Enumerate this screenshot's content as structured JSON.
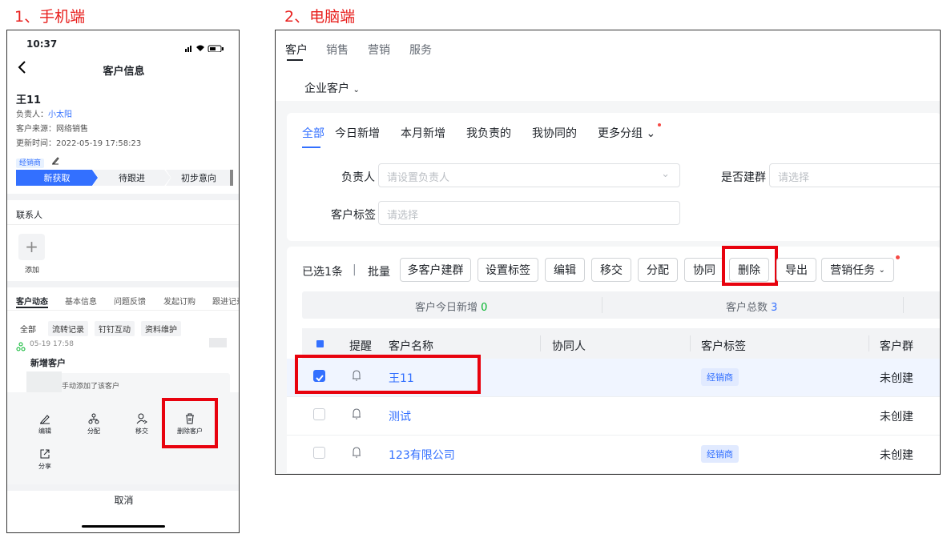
{
  "section1_title": "1、手机端",
  "section2_title": "2、电脑端",
  "mobile": {
    "time": "10:37",
    "nav_title": "客户信息",
    "customer_name": "王11",
    "owner_label": "负责人：",
    "owner_value": "小太阳",
    "source": "客户来源：网络销售",
    "updated": "更新时间：2022-05-19 17:58:23",
    "tag": "经销商",
    "stages": [
      "新获取",
      "待跟进",
      "初步意向"
    ],
    "contacts_title": "联系人",
    "add_label": "添加",
    "tabs": [
      "客户动态",
      "基本信息",
      "问题反馈",
      "发起订购",
      "跟进记录"
    ],
    "filters": [
      "全部",
      "流转记录",
      "钉钉互动",
      "资料维护"
    ],
    "event_time": "05-19 17:58",
    "event_title": "新增客户",
    "event_desc": "手动添加了该客户",
    "actions": [
      "编辑",
      "分配",
      "移交",
      "删除客户"
    ],
    "share_label": "分享",
    "cancel_label": "取消"
  },
  "desktop": {
    "top_tabs": [
      "客户",
      "销售",
      "营销",
      "服务"
    ],
    "scope_select": "企业客户",
    "filter_tabs": [
      "全部",
      "今日新增",
      "本月新增",
      "我负责的",
      "我协同的",
      "更多分组"
    ],
    "owner_label": "负责人",
    "owner_placeholder": "请设置负责人",
    "group_label": "是否建群",
    "group_placeholder": "请选择",
    "tag_label": "客户标签",
    "tag_placeholder": "请选择",
    "selected_text": "已选1条",
    "divider": "|",
    "batch_label": "批量",
    "buttons": [
      "多客户建群",
      "设置标签",
      "编辑",
      "移交",
      "分配",
      "协同",
      "删除",
      "导出",
      "营销任务"
    ],
    "stats": [
      {
        "label": "客户今日新增",
        "value": "0",
        "color": "#00b42a"
      },
      {
        "label": "客户总数",
        "value": "3",
        "color": "#3370ff"
      }
    ],
    "columns": [
      "提醒",
      "客户名称",
      "协同人",
      "客户标签",
      "客户群"
    ],
    "rows": [
      {
        "name": "王11",
        "tag": "经销商",
        "group": "未创建",
        "checked": true
      },
      {
        "name": "测试",
        "tag": "",
        "group": "未创建",
        "checked": false
      },
      {
        "name": "123有限公司",
        "tag": "经销商",
        "group": "未创建",
        "checked": false
      }
    ]
  },
  "colors": {
    "accent": "#3370ff",
    "highlight": "#e8020e",
    "title_red": "#e8201e"
  }
}
